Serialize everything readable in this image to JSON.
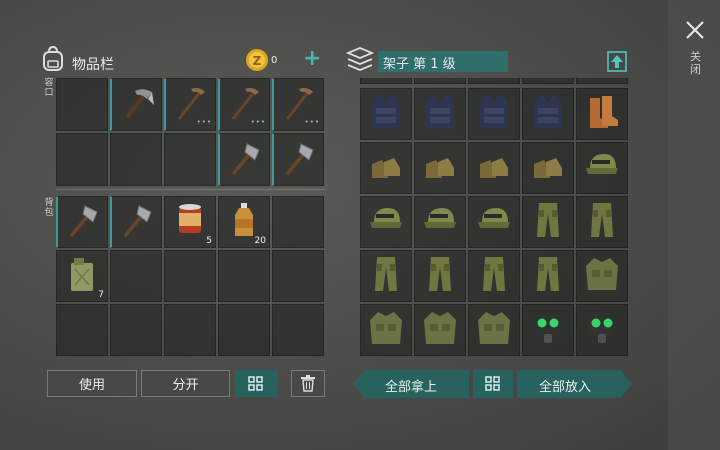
{
  "inventory": {
    "title": "物品栏",
    "coin_count": "0",
    "add_symbol": "+",
    "section_container": "容口",
    "section_backpack": "背包",
    "container_slots": [
      {
        "item": "empty"
      },
      {
        "item": "pickaxe-icon",
        "variant": "steel"
      },
      {
        "item": "pickaxe-icon",
        "variant": "crude",
        "dots": "•••"
      },
      {
        "item": "pickaxe-icon",
        "variant": "crude",
        "dots": "•••"
      },
      {
        "item": "pickaxe-icon",
        "variant": "crude",
        "dots": "•••"
      },
      {
        "item": "empty"
      },
      {
        "item": "empty"
      },
      {
        "item": "empty"
      },
      {
        "item": "hatchet-icon",
        "variant": "stone"
      },
      {
        "item": "hatchet-icon",
        "variant": "stone"
      }
    ],
    "backpack_slots": [
      {
        "item": "hatchet-icon",
        "variant": "stone"
      },
      {
        "item": "hatchet-icon",
        "variant": "stone"
      },
      {
        "item": "canned-food-icon",
        "qty": "5"
      },
      {
        "item": "water-bottle-icon",
        "qty": "20"
      },
      {
        "item": "empty"
      },
      {
        "item": "jerrycan-icon",
        "qty": "7"
      },
      {
        "item": "empty"
      },
      {
        "item": "empty"
      },
      {
        "item": "empty"
      },
      {
        "item": "empty"
      },
      {
        "item": "empty"
      },
      {
        "item": "empty"
      },
      {
        "item": "empty"
      },
      {
        "item": "empty"
      },
      {
        "item": "empty"
      }
    ],
    "use_label": "使用",
    "split_label": "分开",
    "sort_icon": "grid-sort-icon",
    "trash_icon": "trash-icon"
  },
  "shelf": {
    "title": "架子 第 1 级",
    "upgrade_icon": "upgrade-icon",
    "slots": [
      "vest-icon",
      "vest-icon",
      "vest-icon",
      "vest-icon",
      "boots-leather-icon",
      "boots-icon",
      "boots-icon",
      "boots-icon",
      "boots-icon",
      "cap-icon",
      "cap-icon",
      "cap-icon",
      "cap-icon",
      "pants-icon",
      "pants-icon",
      "pants-icon",
      "pants-icon",
      "pants-icon",
      "pants-icon",
      "jacket-icon",
      "jacket-icon",
      "jacket-icon",
      "jacket-icon",
      "gasmask-icon",
      "gasmask-icon"
    ],
    "take_all_label": "全部拿上",
    "put_all_label": "全部放入"
  },
  "close_label": "关闭",
  "colors": {
    "teal": "#27625f",
    "accent": "#3b9c98"
  }
}
